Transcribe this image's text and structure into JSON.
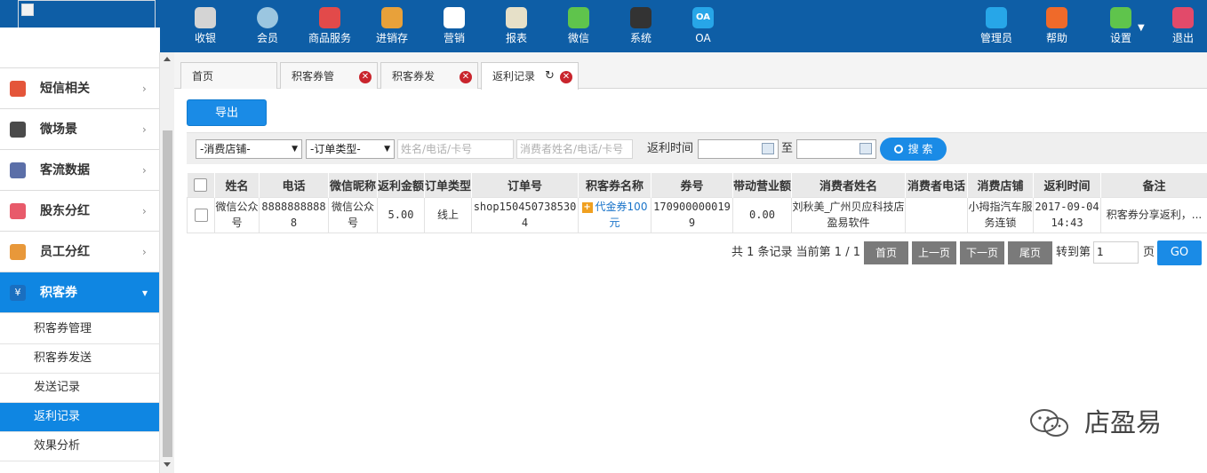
{
  "nav": {
    "items": [
      {
        "label": "收银",
        "icon": "cash-register-icon",
        "color": "#d4d4d4"
      },
      {
        "label": "会员",
        "icon": "member-icon",
        "color": "#9bc6e0"
      },
      {
        "label": "商品服务",
        "icon": "goods-service-icon",
        "color": "#e24a4a"
      },
      {
        "label": "进销存",
        "icon": "inventory-icon",
        "color": "#e8a13a"
      },
      {
        "label": "营销",
        "icon": "marketing-icon",
        "color": "#ffffff"
      },
      {
        "label": "报表",
        "icon": "report-icon",
        "color": "#e6e0c8"
      },
      {
        "label": "微信",
        "icon": "wechat-icon",
        "color": "#5fc44c"
      },
      {
        "label": "系统",
        "icon": "system-icon",
        "color": "#333333"
      },
      {
        "label": "OA",
        "icon": "oa-icon",
        "color": "#27a6e8",
        "tag": "OA"
      }
    ],
    "right": [
      {
        "label": "管理员",
        "icon": "admin-icon",
        "color": "#27a6e8"
      },
      {
        "label": "帮助",
        "icon": "help-icon",
        "color": "#ef6a2a"
      },
      {
        "label": "设置",
        "icon": "settings-icon",
        "color": "#5fc44c"
      },
      {
        "label": "退出",
        "icon": "logout-icon",
        "color": "#e24a6a"
      }
    ]
  },
  "sidebar": {
    "items": [
      {
        "label": "短信相关",
        "icon": "phone-icon",
        "color": "#e4553a"
      },
      {
        "label": "微场景",
        "icon": "mobile-icon",
        "color": "#4a4a4a"
      },
      {
        "label": "客流数据",
        "icon": "traffic-icon",
        "color": "#5b6fa8"
      },
      {
        "label": "股东分红",
        "icon": "shareholder-icon",
        "color": "#e85a6a"
      },
      {
        "label": "员工分红",
        "icon": "employee-icon",
        "color": "#e8983a"
      },
      {
        "label": "积客券",
        "icon": "coupon-icon",
        "color": "#1a6fc0"
      }
    ],
    "subitems": [
      {
        "label": "积客券管理"
      },
      {
        "label": "积客券发送"
      },
      {
        "label": "发送记录"
      },
      {
        "label": "返利记录"
      },
      {
        "label": "效果分析"
      }
    ]
  },
  "tabs": [
    {
      "label": "首页"
    },
    {
      "label": "积客券管"
    },
    {
      "label": "积客券发"
    },
    {
      "label": "返利记录"
    }
  ],
  "toolbar": {
    "export_label": "导出"
  },
  "filters": {
    "store_select": "-消费店铺-",
    "order_type_select": "-订单类型-",
    "name_placeholder": "姓名/电话/卡号",
    "consumer_placeholder": "消费者姓名/电话/卡号",
    "rebate_time_label": "返利时间",
    "to_label": "至",
    "search_label": "搜 索"
  },
  "table": {
    "headers": [
      "姓名",
      "电话",
      "微信昵称",
      "返利金额",
      "订单类型",
      "订单号",
      "积客券名称",
      "券号",
      "带动营业额",
      "消费者姓名",
      "消费者电话",
      "消费店铺",
      "返利时间",
      "备注"
    ],
    "rows": [
      {
        "name": "微信公众号",
        "phone": "88888888888",
        "wechat": "微信公众号",
        "rebate": "5.00",
        "order_type": "线上",
        "order_no": "shop1504507385304",
        "coupon_name": "代金券100元",
        "coupon_no": "1709000000199",
        "revenue": "0.00",
        "consumer_name": "刘秋美_广州贝应科技店盈易软件",
        "consumer_phone": "",
        "store": "小拇指汽车服务连锁",
        "time": "2017-09-04 14:43",
        "note": "积客券分享返利，..."
      }
    ]
  },
  "pager": {
    "info": "共 1 条记录 当前第 1 / 1",
    "first": "首页",
    "prev": "上一页",
    "next": "下一页",
    "last": "尾页",
    "goto_label": "转到第",
    "goto_value": "1",
    "page_label": "页",
    "go": "GO"
  },
  "watermark": {
    "text": "店盈易"
  },
  "colors": {
    "topbar": "#0e5ea6",
    "accent": "#1a8be6",
    "active_sidebar": "#0f86e2",
    "close": "#c9252d"
  }
}
